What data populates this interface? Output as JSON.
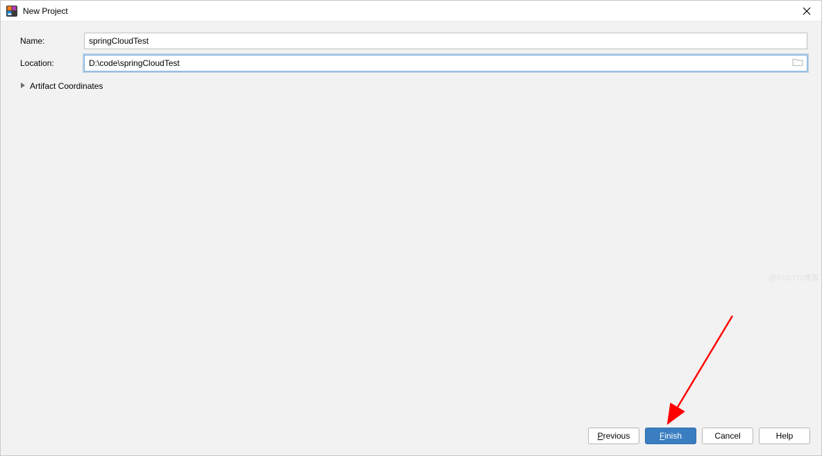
{
  "dialog": {
    "title": "New Project"
  },
  "form": {
    "name_label": "Name:",
    "name_value": "springCloudTest",
    "location_label": "Location:",
    "location_value": "D:\\code\\springCloudTest",
    "artifact_label": "Artifact Coordinates"
  },
  "footer": {
    "previous": {
      "mnemonic": "P",
      "rest": "revious"
    },
    "finish": {
      "mnemonic": "F",
      "rest": "inish"
    },
    "cancel": {
      "text": "Cancel"
    },
    "help": {
      "text": "Help"
    }
  },
  "watermark": "@51CTO博客"
}
